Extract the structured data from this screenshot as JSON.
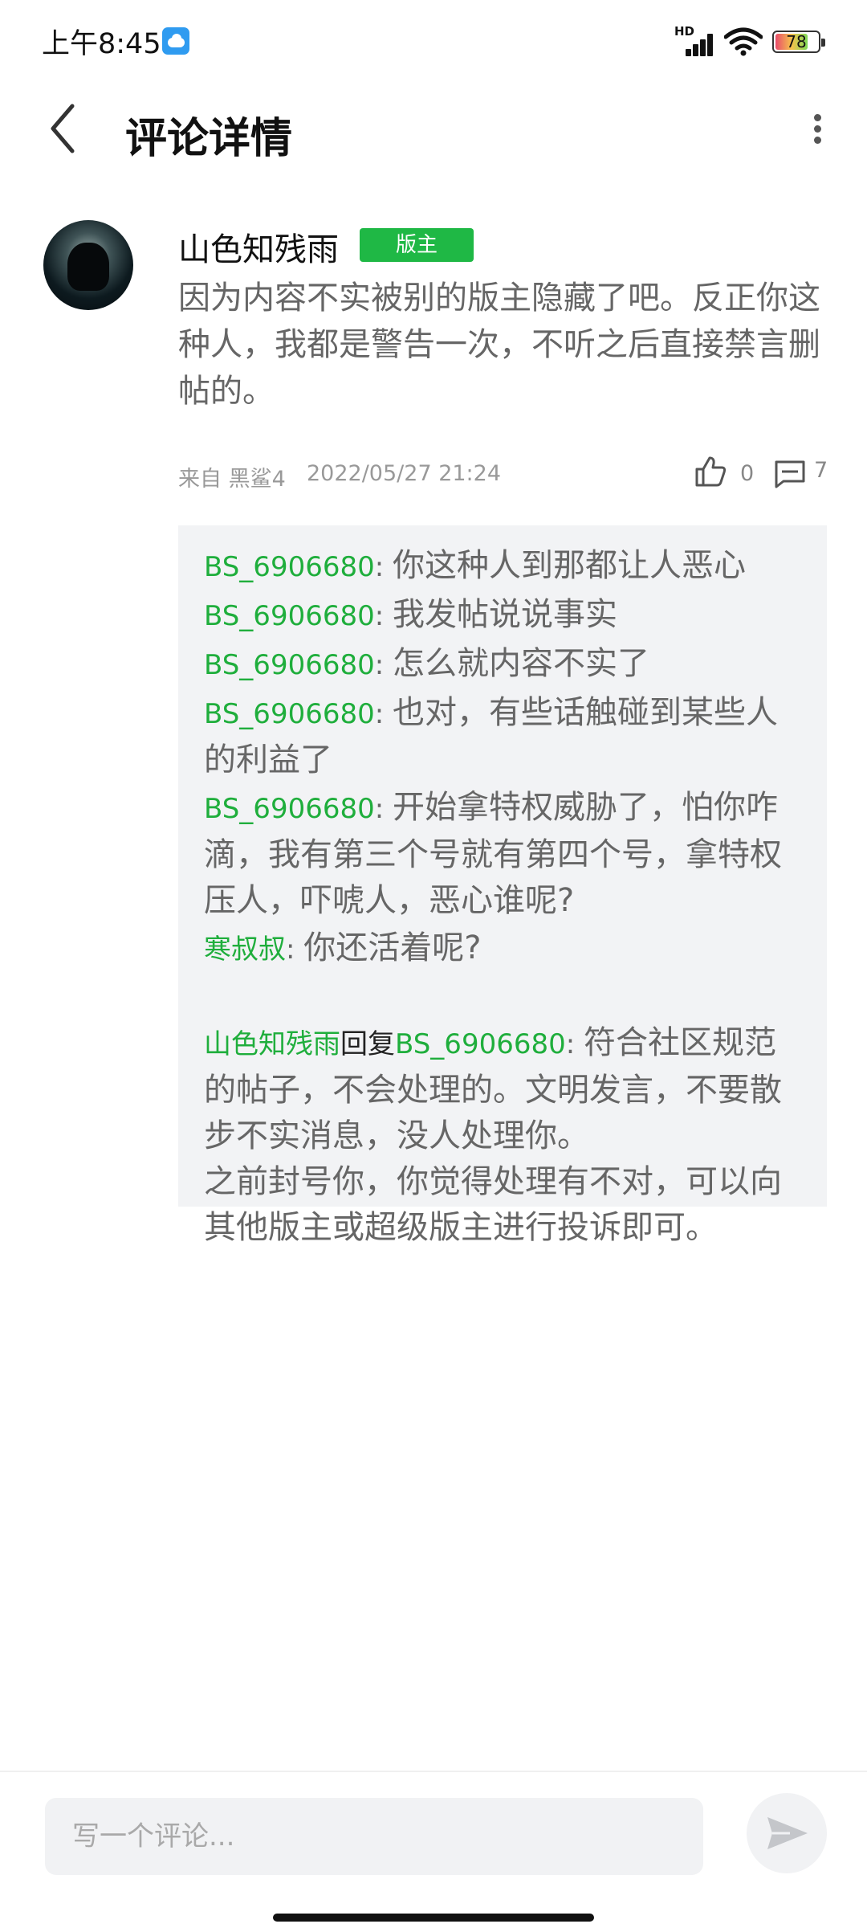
{
  "status_bar": {
    "time": "上午8:45",
    "network_label": "HD",
    "battery_level": "78"
  },
  "header": {
    "title": "评论详情"
  },
  "comment": {
    "author": "山色知残雨",
    "badge": "版主",
    "body": "因为内容不实被别的版主隐藏了吧。反正你这种人，我都是警告一次，不听之后直接禁言删帖的。",
    "source": "来自 黑鲨4",
    "date": "2022/05/27 21:24",
    "likes": "0",
    "replies": "7"
  },
  "replies": [
    {
      "user": "BS_6906680",
      "separator": ": ",
      "text": "你这种人到那都让人恶心"
    },
    {
      "user": "BS_6906680",
      "separator": ": ",
      "text": "我发帖说说事实"
    },
    {
      "user": "BS_6906680",
      "separator": ": ",
      "text": "怎么就内容不实了"
    },
    {
      "user": "BS_6906680",
      "separator": ": ",
      "text": "也对，有些话触碰到某些人的利益了"
    },
    {
      "user": "BS_6906680",
      "separator": ": ",
      "text": "开始拿特权威胁了，怕你咋滴，我有第三个号就有第四个号，拿特权压人，吓唬人，恶心谁呢?"
    },
    {
      "user": "寒叔叔",
      "separator": ": ",
      "text": "你还活着呢?"
    },
    {
      "user": "山色知残雨",
      "reply_word": "回复",
      "reply_target": "BS_6906680",
      "separator": ": ",
      "text": "符合社区规范的帖子，不会处理的。文明发言，不要散步不实消息，没人处理你。\n之前封号你，你觉得处理有不对，可以向其他版主或超级版主进行投诉即可。"
    }
  ],
  "input": {
    "placeholder": "写一个评论..."
  },
  "colors": {
    "accent_green": "#1fb845",
    "reply_bg": "#f2f3f5"
  },
  "icons": [
    "cloud-icon",
    "signal-icon",
    "wifi-icon",
    "battery-icon",
    "back-icon",
    "more-icon",
    "like-icon",
    "reply-icon",
    "send-icon"
  ]
}
